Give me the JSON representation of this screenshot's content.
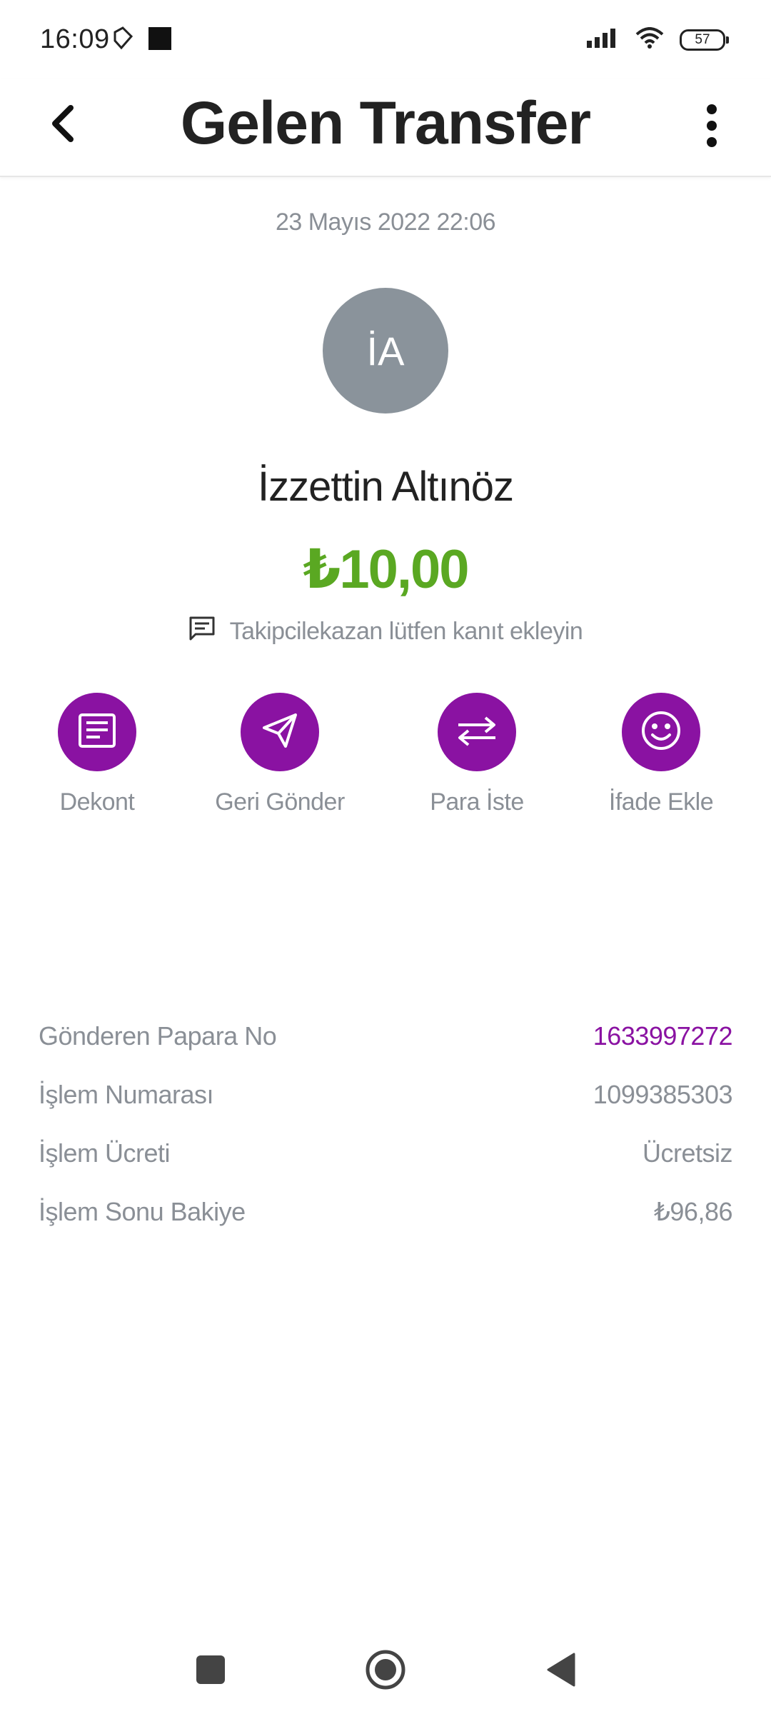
{
  "status_bar": {
    "time": "16:09",
    "battery": "57",
    "icons": [
      "tag-icon",
      "square-notification-icon",
      "signal-icon",
      "wifi-icon",
      "battery-icon"
    ]
  },
  "app_bar": {
    "title": "Gelen Transfer",
    "back_icon": "chevron-left-icon",
    "more_icon": "more-vertical-icon"
  },
  "transaction": {
    "date": "23 Mayıs 2022 22:06",
    "avatar_initials": "İA",
    "sender_name": "İzzettin Altınöz",
    "amount": "₺10,00",
    "note": "Takipcilekazan  lütfen kanıt ekleyin"
  },
  "actions": [
    {
      "label": "Dekont",
      "icon": "receipt-icon"
    },
    {
      "label": "Geri Gönder",
      "icon": "send-icon"
    },
    {
      "label": "Para İste",
      "icon": "swap-arrows-icon"
    },
    {
      "label": "İfade Ekle",
      "icon": "smiley-icon"
    }
  ],
  "details": [
    {
      "label": "Gönderen Papara No",
      "value": "1633997272"
    },
    {
      "label": "İşlem Numarası",
      "value": "1099385303"
    },
    {
      "label": "İşlem Ücreti",
      "value": "Ücretsiz"
    },
    {
      "label": "İşlem Sonu Bakiye",
      "value": "₺96,86"
    }
  ],
  "colors": {
    "accent": "#8a12a2",
    "amount": "#5aa822",
    "muted_text": "#8a8f96",
    "avatar_bg": "#8a939b"
  }
}
